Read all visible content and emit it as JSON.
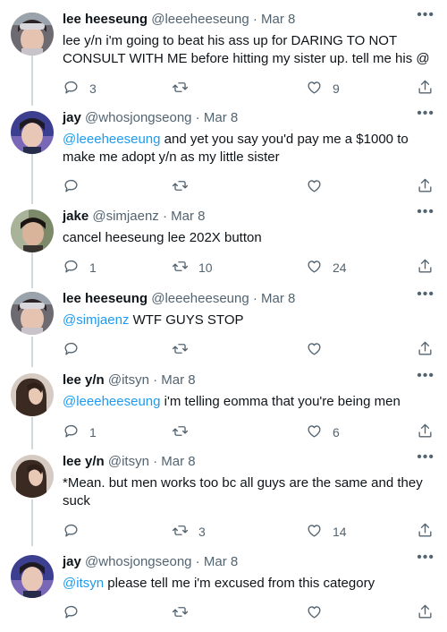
{
  "tweets": [
    {
      "name": "lee heeseung",
      "handle": "@leeeheeseung",
      "date": "Mar 8",
      "text": "lee y/n i'm going to beat his ass up for DARING TO NOT CONSULT WITH ME before hitting my sister up. tell me his @",
      "mention": "",
      "replies": "3",
      "retweets": "",
      "likes": "9"
    },
    {
      "name": "jay",
      "handle": "@whosjongseong",
      "date": "Mar 8",
      "mention": "@leeeheeseung",
      "text": " and yet you say you'd pay me a $1000 to make me adopt y/n as my little sister",
      "replies": "",
      "retweets": "",
      "likes": ""
    },
    {
      "name": "jake",
      "handle": "@simjaenz",
      "date": "Mar 8",
      "mention": "",
      "text": "cancel heeseung lee 202X button",
      "replies": "1",
      "retweets": "10",
      "likes": "24"
    },
    {
      "name": "lee heeseung",
      "handle": "@leeeheeseung",
      "date": "Mar 8",
      "mention": "@simjaenz",
      "text": " WTF GUYS STOP",
      "replies": "",
      "retweets": "",
      "likes": ""
    },
    {
      "name": "lee y/n",
      "handle": "@itsyn",
      "date": "Mar 8",
      "mention": "@leeeheeseung",
      "text": " i'm telling eomma that you're being men",
      "replies": "1",
      "retweets": "",
      "likes": "6"
    },
    {
      "name": "lee y/n",
      "handle": "@itsyn",
      "date": "Mar 8",
      "mention": "",
      "text": "*Mean. but men works too bc all guys are the same and they suck",
      "replies": "",
      "retweets": "3",
      "likes": "14"
    },
    {
      "name": "jay",
      "handle": "@whosjongseong",
      "date": "Mar 8",
      "mention": "@itsyn",
      "text": " please tell me i'm excused from this category",
      "replies": "",
      "retweets": "",
      "likes": ""
    }
  ],
  "separator": " · ",
  "more_glyph": "•••",
  "colors": {
    "accent": "#1d9bf0",
    "muted": "#536471",
    "thread_line": "#cfd9de"
  },
  "icons": [
    "reply-icon",
    "retweet-icon",
    "like-icon",
    "share-icon",
    "more-icon"
  ]
}
